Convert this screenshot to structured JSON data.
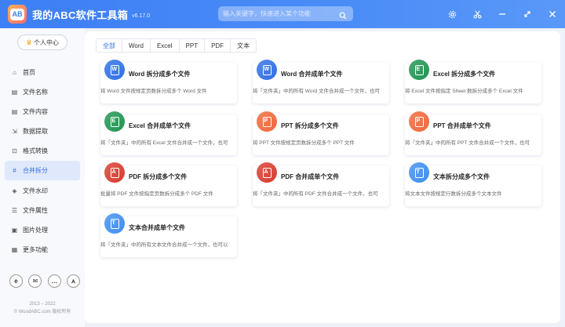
{
  "app": {
    "title": "我的ABC软件工具箱",
    "version": "v6.17.0",
    "logo_text": "AB",
    "search_placeholder": "输入关键字，快速进入某个功能"
  },
  "titlebar_icons": [
    "settings-icon",
    "scissors-icon",
    "minimize-icon",
    "maximize-icon",
    "close-icon"
  ],
  "sidebar": {
    "user_center": "个人中心",
    "items": [
      {
        "label": "首页",
        "icon": "home-icon",
        "glyph": "⌂",
        "active": false
      },
      {
        "label": "文件名称",
        "icon": "rename-icon",
        "glyph": "▤",
        "active": false
      },
      {
        "label": "文件内容",
        "icon": "content-icon",
        "glyph": "▤",
        "active": false
      },
      {
        "label": "数据提取",
        "icon": "extract-icon",
        "glyph": "⇲",
        "active": false
      },
      {
        "label": "格式转换",
        "icon": "convert-icon",
        "glyph": "⊡",
        "active": false
      },
      {
        "label": "合并拆分",
        "icon": "merge-split-icon",
        "glyph": "#",
        "active": true
      },
      {
        "label": "文件水印",
        "icon": "watermark-icon",
        "glyph": "◈",
        "active": false
      },
      {
        "label": "文件属性",
        "icon": "properties-icon",
        "glyph": "☰",
        "active": false
      },
      {
        "label": "图片处理",
        "icon": "image-icon",
        "glyph": "▣",
        "active": false
      },
      {
        "label": "更多功能",
        "icon": "more-icon",
        "glyph": "▦",
        "active": false
      }
    ],
    "social": [
      {
        "icon": "ie-icon",
        "glyph": "e"
      },
      {
        "icon": "mail-icon",
        "glyph": "✉"
      },
      {
        "icon": "chat-icon",
        "glyph": "…"
      },
      {
        "icon": "share-icon",
        "glyph": "⋏"
      }
    ],
    "copyright_years": "2013 – 2022",
    "copyright_text": "© WoodABC.com 版权所有"
  },
  "tabs": [
    {
      "label": "全部",
      "active": true
    },
    {
      "label": "Word",
      "active": false
    },
    {
      "label": "Excel",
      "active": false
    },
    {
      "label": "PPT",
      "active": false
    },
    {
      "label": "PDF",
      "active": false
    },
    {
      "label": "文本",
      "active": false
    }
  ],
  "cards": [
    {
      "title": "Word 拆分成多个文件",
      "desc": "将 Word 文件按规定页数拆分成多个 Word 文件",
      "color": "#2f6fe4",
      "letter": "W"
    },
    {
      "title": "Word 合并成单个文件",
      "desc": "将「文件夹」中的所有 Word 文件合并成一个文件，也可",
      "color": "#2f6fe4",
      "letter": "W"
    },
    {
      "title": "Excel 拆分成多个文件",
      "desc": "将 Excel 文件按指定 Sheet 数拆分成多个 Excel 文件",
      "color": "#1e9550",
      "letter": "E"
    },
    {
      "title": "Excel 合并成单个文件",
      "desc": "将「文件夹」中的所有 Excel 文件合并成一个文件，也可",
      "color": "#1e9550",
      "letter": "E"
    },
    {
      "title": "PPT 拆分成多个文件",
      "desc": "将 PPT 文件按规定页数拆分成多个 PPT 文件",
      "color": "#f0673a",
      "letter": "P"
    },
    {
      "title": "PPT 合并成单个文件",
      "desc": "将「文件夹」中的所有 PPT 文件合并成一个文件，也可",
      "color": "#f0673a",
      "letter": "P"
    },
    {
      "title": "PDF 拆分成多个文件",
      "desc": "批量将 PDF 文件按指定页数拆分成多个 PDF 文件",
      "color": "#d93a2e",
      "letter": "A"
    },
    {
      "title": "PDF 合并成单个文件",
      "desc": "将「文件夹」中的所有 PDF 文件合并成一个文件，也可",
      "color": "#d93a2e",
      "letter": "A"
    },
    {
      "title": "文本拆分成多个文件",
      "desc": "将文本文件按规定行数拆分成多个文本文件",
      "color": "#3f8ef0",
      "letter": "T"
    },
    {
      "title": "文本合并成单个文件",
      "desc": "将「文件夹」中的所有文本文件合并成一个文件，也可以",
      "color": "#3f8ef0",
      "letter": "T"
    }
  ]
}
